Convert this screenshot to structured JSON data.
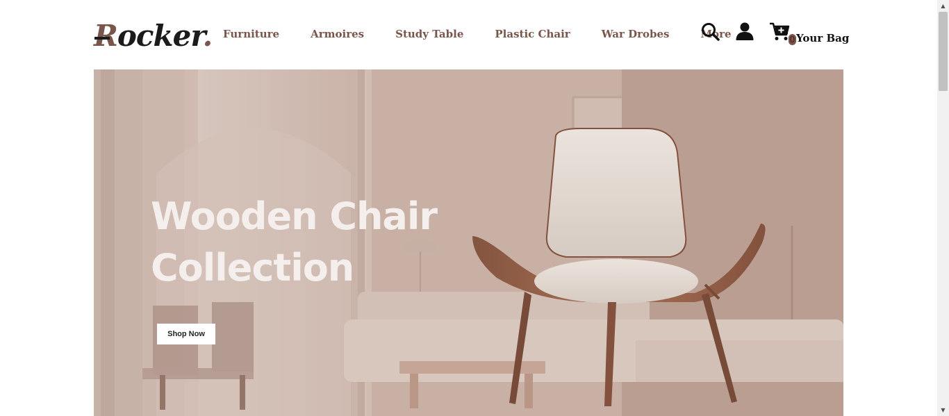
{
  "header": {
    "logo": {
      "first": "R",
      "rest": "ocker",
      "dot": "."
    },
    "nav": [
      {
        "label": "Furniture"
      },
      {
        "label": "Armoires"
      },
      {
        "label": "Study Table"
      },
      {
        "label": "Plastic Chair"
      },
      {
        "label": "War Drobes"
      },
      {
        "label": "More"
      }
    ],
    "icons": [
      "search-icon",
      "user-icon",
      "cart-icon"
    ],
    "bag": {
      "count": "0",
      "label": "Your Bag"
    }
  },
  "hero": {
    "title_line1": "Wooden Chair",
    "title_line2": "Collection",
    "button": "Shop Now"
  },
  "colors": {
    "brand": "#7a554b",
    "hero_bg": "#c9b3a8",
    "text_dark": "#111111"
  }
}
